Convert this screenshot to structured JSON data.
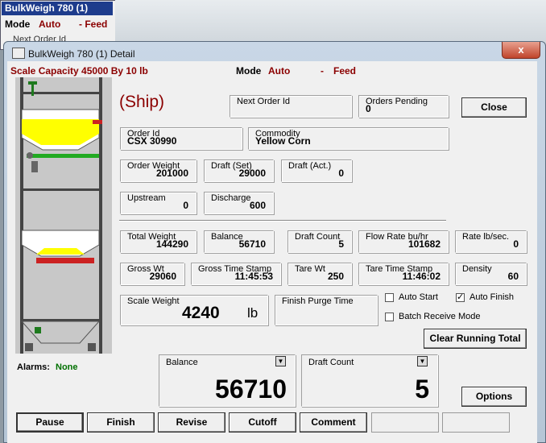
{
  "background_window": {
    "title": "BulkWeigh 780 (1)",
    "mode_label": "Mode",
    "mode_value": "Auto",
    "feed_value": "- Feed",
    "next_order_label": "Next Order Id"
  },
  "window": {
    "title": "BulkWeigh 780 (1) Detail",
    "close_glyph": "x"
  },
  "header": {
    "capacity": "Scale Capacity 45000 By 10 lb",
    "mode_label": "Mode",
    "mode_value": "Auto",
    "dash": "-",
    "feed": "Feed"
  },
  "order": {
    "direction": "(Ship)",
    "next_order_id_label": "Next Order Id",
    "next_order_id": "",
    "orders_pending_label": "Orders Pending",
    "orders_pending": "0",
    "order_id_label": "Order Id",
    "order_id": "CSX 30990",
    "commodity_label": "Commodity",
    "commodity": "Yellow Corn",
    "order_weight_label": "Order Weight",
    "order_weight": "201000",
    "draft_set_label": "Draft (Set)",
    "draft_set": "29000",
    "draft_act_label": "Draft (Act.)",
    "draft_act": "0",
    "upstream_label": "Upstream",
    "upstream": "0",
    "discharge_label": "Discharge",
    "discharge": "600"
  },
  "stats": {
    "total_weight_label": "Total Weight",
    "total_weight": "144290",
    "balance_label": "Balance",
    "balance": "56710",
    "draft_count_label": "Draft Count",
    "draft_count": "5",
    "flow_rate_label": "Flow Rate bu/hr",
    "flow_rate": "101682",
    "rate_label": "Rate lb/sec.",
    "rate": "0",
    "gross_wt_label": "Gross Wt",
    "gross_wt": "29060",
    "gross_ts_label": "Gross Time Stamp",
    "gross_ts": "11:45:53",
    "tare_wt_label": "Tare Wt",
    "tare_wt": "250",
    "tare_ts_label": "Tare Time Stamp",
    "tare_ts": "11:46:02",
    "density_label": "Density",
    "density": "60",
    "scale_weight_label": "Scale Weight",
    "scale_weight": "4240",
    "scale_unit": "lb",
    "finish_purge_label": "Finish Purge Time",
    "finish_purge": ""
  },
  "options": {
    "auto_start_label": "Auto Start",
    "auto_start_checked": false,
    "auto_finish_label": "Auto Finish",
    "auto_finish_checked": true,
    "batch_receive_label": "Batch Receive Mode",
    "batch_receive_checked": false,
    "check_glyph": "✓"
  },
  "big_displays": {
    "left_label": "Balance",
    "left_value": "56710",
    "right_label": "Draft Count",
    "right_value": "5",
    "dropdown_glyph": "▼"
  },
  "alarms": {
    "label": "Alarms:",
    "value": "None",
    "value_color": "#007000"
  },
  "buttons": {
    "close": "Close",
    "clear_running_total": "Clear Running Total",
    "options": "Options",
    "pause": "Pause",
    "finish": "Finish",
    "revise": "Revise",
    "cutoff": "Cutoff",
    "comment": "Comment"
  },
  "colors": {
    "accent_red": "#8b0000",
    "title_blue": "#1e3c8c",
    "product_yellow": "#ffff00",
    "gate_green": "#22aa22",
    "gate_red": "#cc2222"
  }
}
